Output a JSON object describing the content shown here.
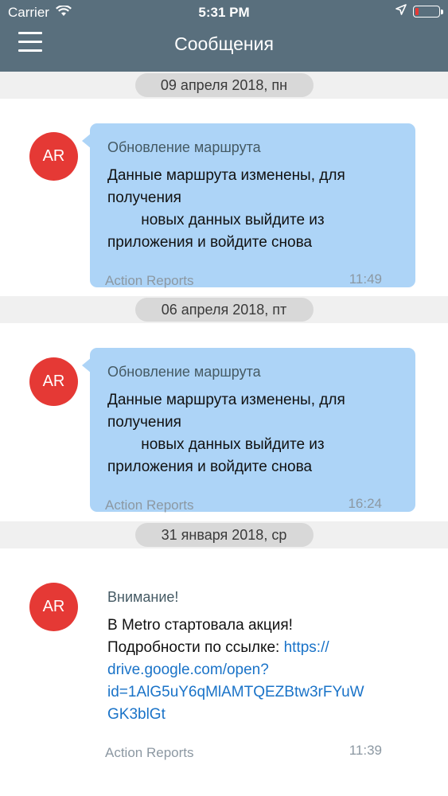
{
  "status_bar": {
    "carrier": "Carrier",
    "time": "5:31 PM"
  },
  "header": {
    "title": "Сообщения"
  },
  "messages": [
    {
      "date": "09 апреля 2018, пн",
      "avatar": "AR",
      "title": "Обновление маршрута",
      "body_lines": [
        "Данные маршрута изменены, для",
        "получения",
        "        новых данных выйдите из",
        "приложения и войдите снова"
      ],
      "sender": "Action Reports",
      "time": "11:49"
    },
    {
      "date": "06 апреля 2018, пт",
      "avatar": "AR",
      "title": "Обновление маршрута",
      "body_lines": [
        "Данные маршрута изменены, для",
        "получения",
        "        новых данных выйдите из",
        "приложения и войдите снова"
      ],
      "sender": "Action Reports",
      "time": "16:24"
    },
    {
      "date": "31 января 2018, ср",
      "avatar": "AR",
      "title": "Внимание!",
      "body_lines": [
        "В Metro стартовала акция!",
        "Подробности по ссылке: "
      ],
      "link_lines": [
        "https://",
        "drive.google.com/open?",
        "id=1AlG5uY6qMlAMTQEZBtw3rFYuW",
        "GK3blGt"
      ],
      "sender": "Action Reports",
      "time": "11:39"
    }
  ],
  "colors": {
    "header": "#596f7d",
    "bubble": "#add4f7",
    "avatar": "#e53935",
    "link": "#1a73c8"
  }
}
